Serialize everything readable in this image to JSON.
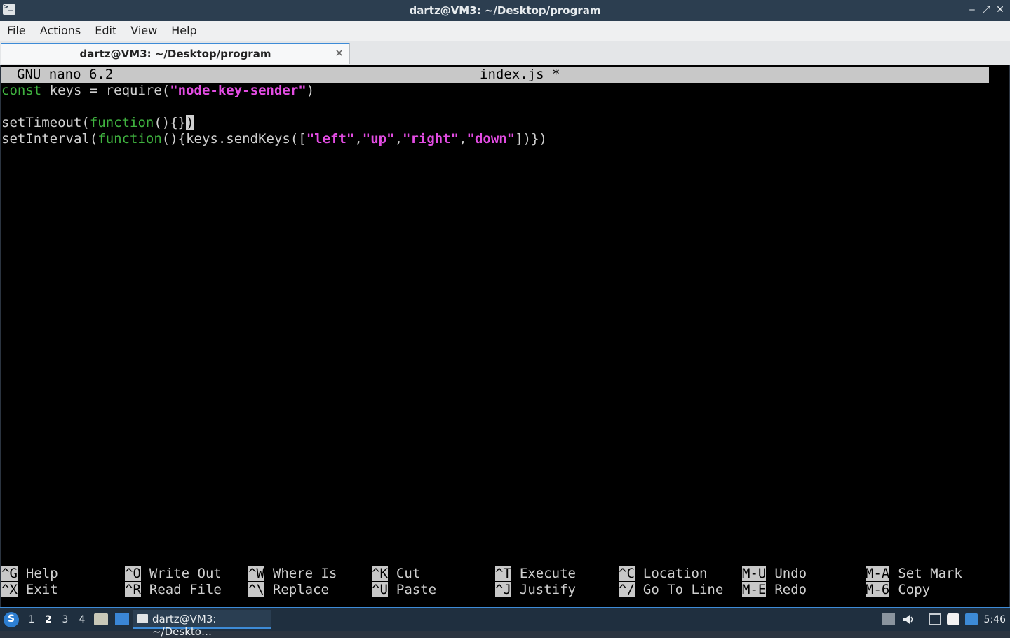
{
  "window": {
    "title": "dartz@VM3: ~/Desktop/program",
    "minimize_glyph": "‒",
    "maximize_glyph": "⤢",
    "close_glyph": "✕"
  },
  "menu": {
    "items": [
      "File",
      "Actions",
      "Edit",
      "View",
      "Help"
    ]
  },
  "tabs": [
    {
      "label": "dartz@VM3: ~/Desktop/program",
      "close_glyph": "✕"
    }
  ],
  "nano": {
    "version": "GNU nano 6.2",
    "filename": "index.js *",
    "lines": [
      "const keys = require(\"node-key-sender\")",
      "",
      "setTimeout(function(){})",
      "setInterval(function(){keys.sendKeys([\"left\",\"up\",\"right\",\"down\"])})"
    ],
    "shortcuts_row1": [
      {
        "key": "^G",
        "label": "Help"
      },
      {
        "key": "^O",
        "label": "Write Out"
      },
      {
        "key": "^W",
        "label": "Where Is"
      },
      {
        "key": "^K",
        "label": "Cut"
      },
      {
        "key": "^T",
        "label": "Execute"
      },
      {
        "key": "^C",
        "label": "Location"
      },
      {
        "key": "M-U",
        "label": "Undo"
      },
      {
        "key": "M-A",
        "label": "Set Mark"
      }
    ],
    "shortcuts_row2": [
      {
        "key": "^X",
        "label": "Exit"
      },
      {
        "key": "^R",
        "label": "Read File"
      },
      {
        "key": "^\\",
        "label": "Replace"
      },
      {
        "key": "^U",
        "label": "Paste"
      },
      {
        "key": "^J",
        "label": "Justify"
      },
      {
        "key": "^/",
        "label": "Go To Line"
      },
      {
        "key": "M-E",
        "label": "Redo"
      },
      {
        "key": "M-6",
        "label": "Copy"
      }
    ]
  },
  "taskbar": {
    "workspaces": [
      "1",
      "2",
      "3",
      "4"
    ],
    "active_workspace": "2",
    "task_label": "dartz@VM3: ~/Deskto…",
    "clock": "5:46",
    "tray_icons": [
      "network-icon",
      "volume-icon",
      "monitor-icon",
      "clipboard-icon",
      "update-icon"
    ]
  },
  "colors": {
    "keyword": "#3fb23f",
    "string": "#e24ce2",
    "accent": "#3d8bd7"
  }
}
